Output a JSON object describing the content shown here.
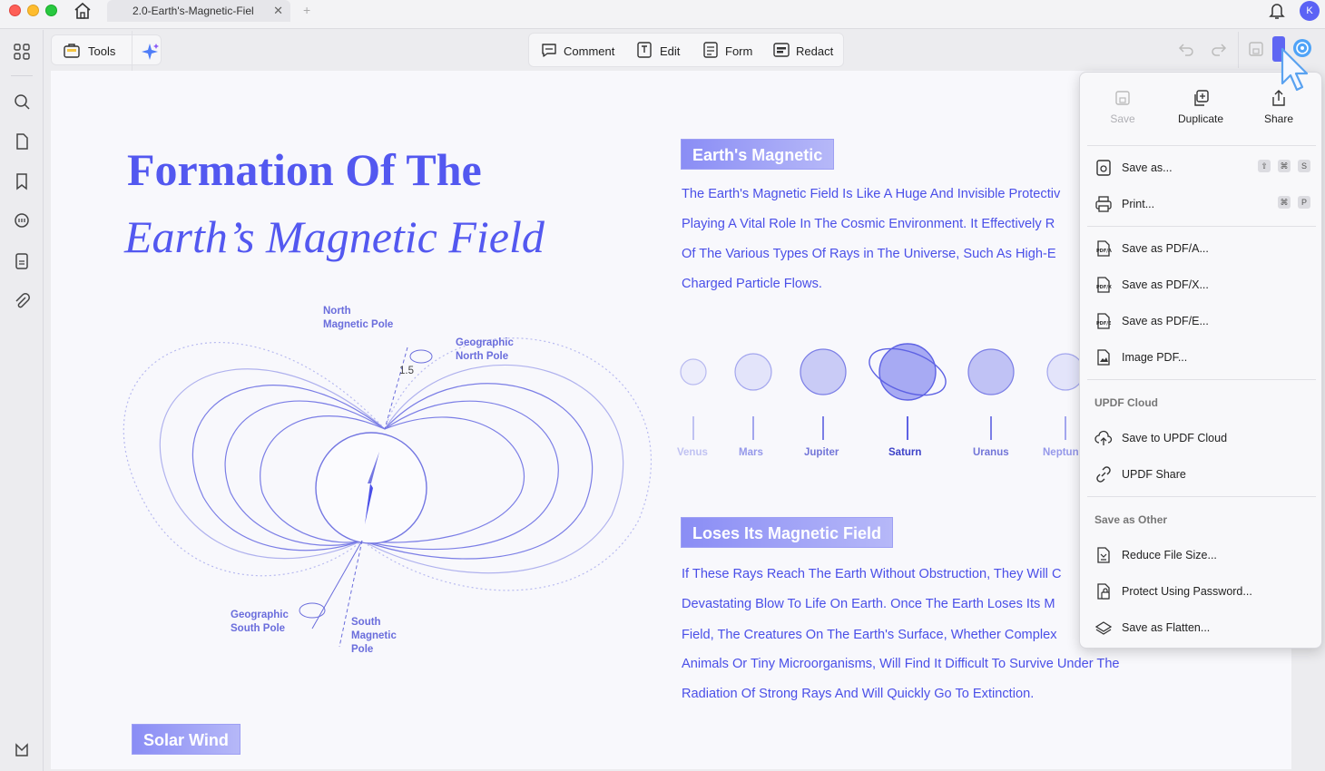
{
  "window": {
    "tab_title": "2.0-Earth's-Magnetic-Fiel",
    "avatar_letter": "K"
  },
  "toolbar": {
    "tools_label": "Tools",
    "comment_label": "Comment",
    "edit_label": "Edit",
    "form_label": "Form",
    "redact_label": "Redact"
  },
  "document": {
    "title_line1": "Formation Of The",
    "title_line2": "Earth’s Magnetic Field",
    "section1_tag": "Earth's Magnetic",
    "section1_lines": [
      "The Earth's Magnetic Field Is Like A Huge And Invisible Protectiv",
      "Playing A Vital Role In The Cosmic Environment. It Effectively R",
      "Of The Various Types Of Rays in The Universe, Such As High-E",
      "Charged Particle Flows."
    ],
    "planets": [
      "Venus",
      "Mars",
      "Jupiter",
      "Saturn",
      "Uranus",
      "Neptun"
    ],
    "section2_tag": "Loses Its Magnetic Field",
    "section2_lines": [
      "If These Rays Reach The Earth Without Obstruction, They Will C",
      "Devastating Blow To Life On Earth. Once The Earth Loses Its M",
      "Field, The Creatures On The Earth's Surface, Whether Complex",
      "Animals Or Tiny Microorganisms, Will Find It Difficult To Survive Under The",
      "Radiation Of Strong Rays And Will Quickly Go To Extinction."
    ],
    "section3_tag": "Solar Wind",
    "diagram": {
      "north_magnetic_pole": [
        "North",
        "Magnetic Pole"
      ],
      "geographic_north_pole": [
        "Geographic",
        "North Pole"
      ],
      "angle": "1.5",
      "geographic_south_pole": [
        "Geographic",
        "South Pole"
      ],
      "south_magnetic_pole": [
        "South",
        "Magnetic",
        "Pole"
      ]
    }
  },
  "menu": {
    "save_label": "Save",
    "duplicate_label": "Duplicate",
    "share_label": "Share",
    "items": {
      "save_as": "Save as...",
      "print": "Print...",
      "save_pdfa": "Save as PDF/A...",
      "save_pdfx": "Save as PDF/X...",
      "save_pdfe": "Save as PDF/E...",
      "image_pdf": "Image PDF...",
      "save_cloud": "Save to UPDF Cloud",
      "updf_share": "UPDF Share",
      "reduce_size": "Reduce File Size...",
      "protect_pw": "Protect Using Password...",
      "save_flatten": "Save as Flatten..."
    },
    "section_cloud": "UPDF Cloud",
    "section_other": "Save as Other",
    "shortcuts": {
      "save_as": [
        "⇧",
        "⌘",
        "S"
      ],
      "print": [
        "⌘",
        "P"
      ]
    },
    "pdf_badges": {
      "a": "PDF/A",
      "x": "PDF/X",
      "e": "PDF/E"
    }
  },
  "colors": {
    "accent": "#5358f0",
    "text_blue": "#4a4fe8",
    "menu_bg": "#f8f8fa"
  }
}
